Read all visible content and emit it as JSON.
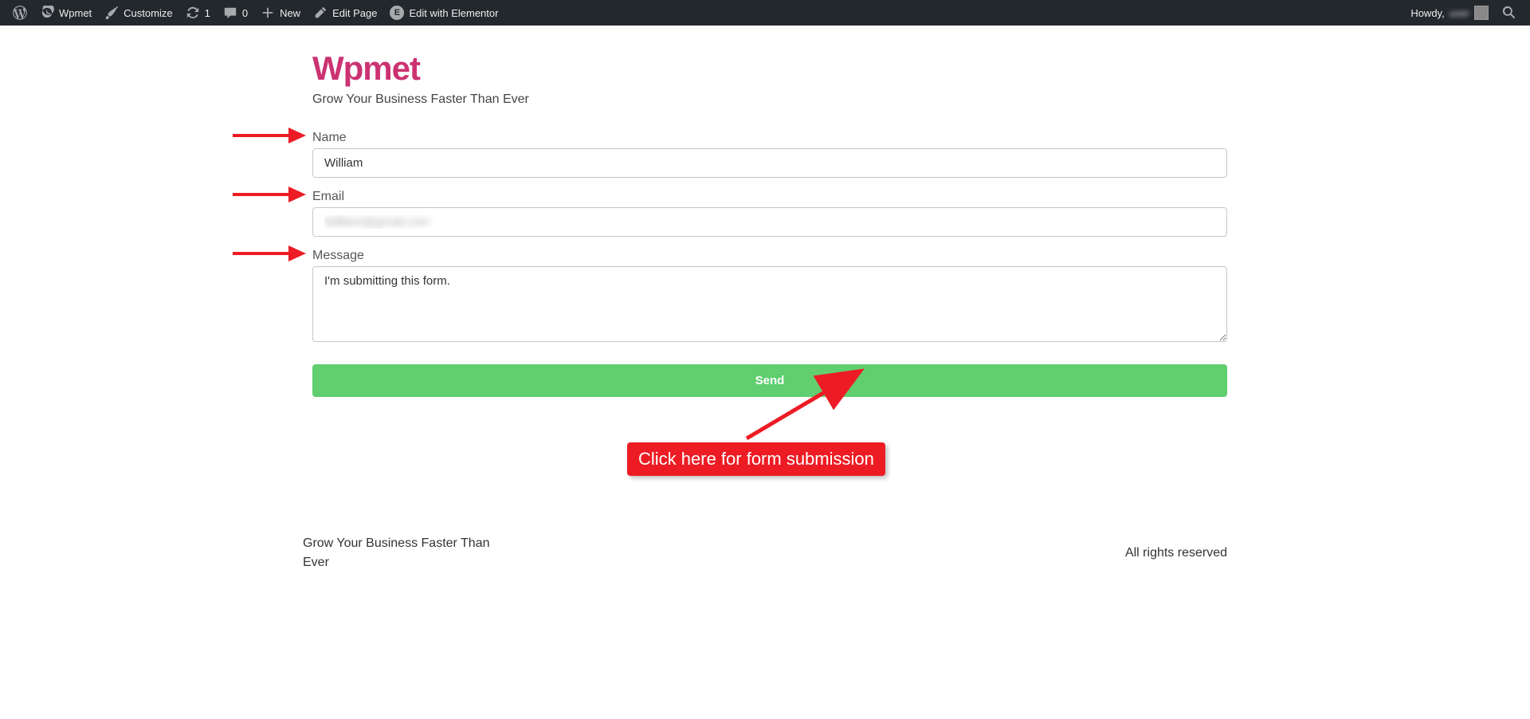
{
  "adminbar": {
    "site_name": "Wpmet",
    "customize": "Customize",
    "updates_count": "1",
    "comments_count": "0",
    "new": "New",
    "edit_page": "Edit Page",
    "edit_elementor": "Edit with Elementor",
    "howdy": "Howdy,",
    "username_blur": "user"
  },
  "header": {
    "title": "Wpmet",
    "tagline": "Grow Your Business Faster Than Ever"
  },
  "form": {
    "name_label": "Name",
    "name_value": "William",
    "email_label": "Email",
    "email_value": "William@gmail.com",
    "message_label": "Message",
    "message_value": "I'm submitting this form.",
    "submit_label": "Send"
  },
  "annotation": {
    "text": "Click here for form submission"
  },
  "footer": {
    "left": "Grow Your Business Faster Than Ever",
    "right": "All rights reserved"
  }
}
